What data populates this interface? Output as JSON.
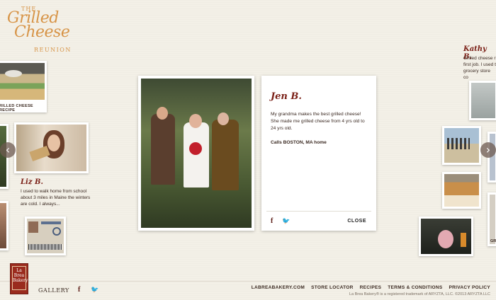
{
  "logo": {
    "the": "THE",
    "line1": "Grilled",
    "line2": "Cheese",
    "reunion": "REUNION"
  },
  "recipe_tile": {
    "label": "RILLED CHEESE RECIPE"
  },
  "recipe_tile_right": {
    "label": "GR"
  },
  "people": {
    "liz": {
      "name": "Liz B.",
      "snippet": "I used to walk home from school about 3 miles in Maine the winters are cold. I always..."
    },
    "kathy": {
      "name": "Kathy B.",
      "snippet": "Grilled cheese r first job. I used t grocery store co"
    }
  },
  "modal": {
    "name": "Jen B.",
    "story": "My grandma makes the best grilled cheese! She made me grilled cheese from 4 yrs old to 24 yrs old.",
    "calls": "Calls BOSTON, MA home",
    "fb": "f",
    "tw": "🐦",
    "close": "CLOSE"
  },
  "arrows": {
    "left": "‹",
    "right": "›"
  },
  "footer": {
    "brand_lines": [
      "La",
      "Brea",
      "Bakery"
    ],
    "gallery": "GALLERY",
    "fb": "f",
    "tw": "🐦",
    "links": [
      "LABREABAKERY.COM",
      "STORE LOCATOR",
      "RECIPES",
      "TERMS & CONDITIONS",
      "PRIVACY POLICY"
    ],
    "legal": "La Brea Bakery® is a registered trademark of ARYZTA, LLC. ©2013 ARYZTA LLC"
  },
  "colors": {
    "accent": "#7a1f16",
    "logo": "#d79447",
    "background": "#f3f0e7"
  }
}
